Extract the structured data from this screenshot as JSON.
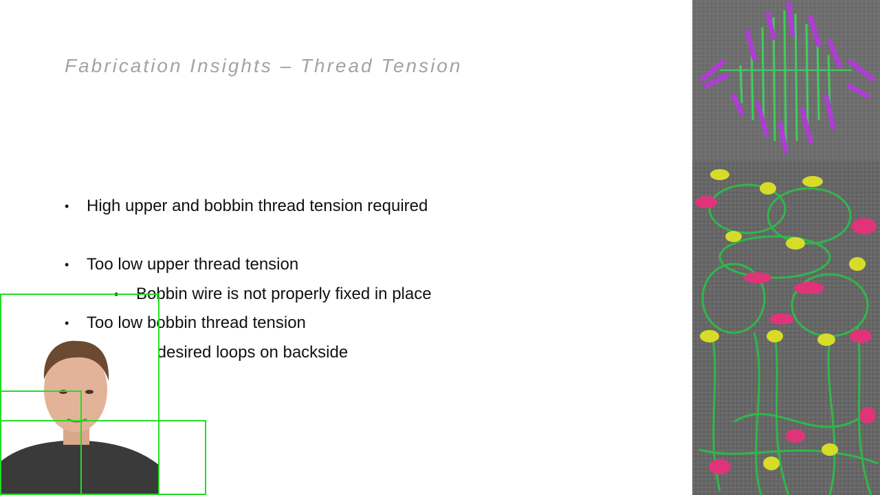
{
  "slide": {
    "title": "Fabrication Insights – Thread Tension",
    "bullets": [
      {
        "level": 1,
        "text": "High upper and bobbin thread tension required"
      },
      {
        "level": 1,
        "text": "Too low upper thread tension"
      },
      {
        "level": 2,
        "text": "Bobbin wire is not properly fixed in place"
      },
      {
        "level": 1,
        "text": "Too low bobbin thread tension"
      },
      {
        "level": 2,
        "text": "Undesired loops on backside"
      }
    ],
    "bullet_glyph": "•"
  },
  "images": {
    "top_photo": "embroidered-diamond-photo",
    "bottom_photo": "thread-loops-closeup-photo",
    "presenter": "presenter-webcam"
  },
  "colors": {
    "title": "#a3a3a3",
    "text": "#111111",
    "overlay_box": "#22dd22",
    "stitch_purple": "#b03cd6",
    "wire_green": "#2fb84a",
    "thread_pink": "#e0347a",
    "thread_yellow": "#d6dc28",
    "felt_gray": "#6e6e6e"
  }
}
